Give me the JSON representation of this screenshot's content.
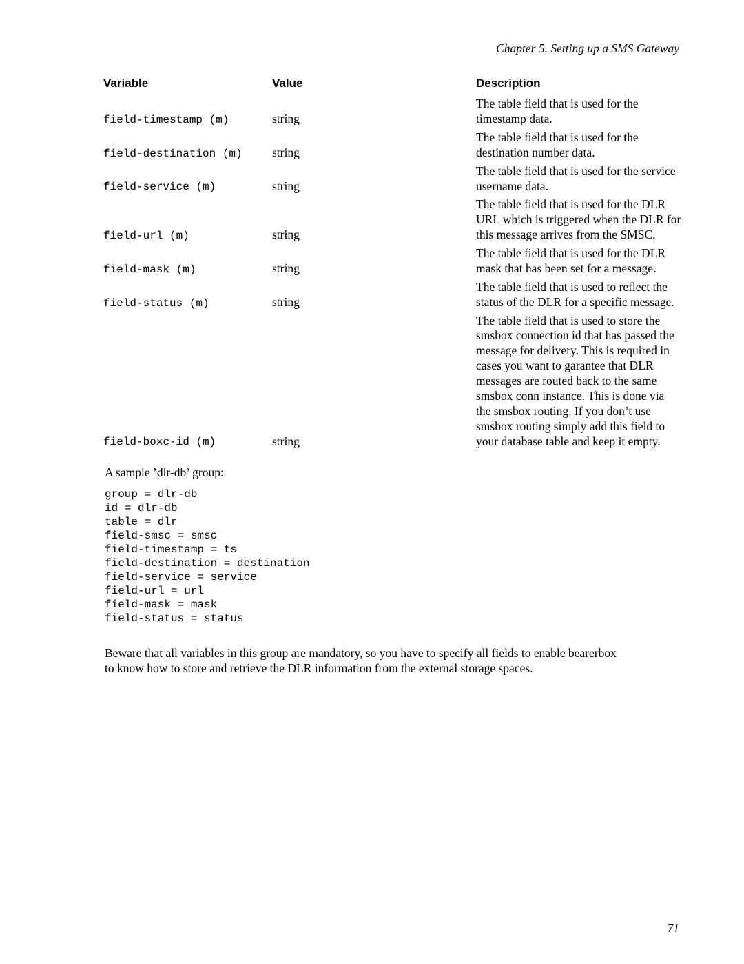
{
  "header": {
    "running_head": "Chapter 5. Setting up a SMS Gateway"
  },
  "table": {
    "columns": {
      "variable": "Variable",
      "value": "Value",
      "description": "Description"
    },
    "rows": [
      {
        "variable": "field-timestamp (m)",
        "value": "string",
        "description": "The table field that is used for the timestamp data."
      },
      {
        "variable": "field-destination (m)",
        "value": "string",
        "description": "The table field that is used for the destination number data."
      },
      {
        "variable": "field-service (m)",
        "value": "string",
        "description": "The table field that is used for the service username data."
      },
      {
        "variable": "field-url (m)",
        "value": "string",
        "description": "The table field that is used for the DLR URL which is triggered when the DLR for this message arrives from the SMSC."
      },
      {
        "variable": "field-mask (m)",
        "value": "string",
        "description": "The table field that is used for the DLR mask that has been set for a message."
      },
      {
        "variable": "field-status (m)",
        "value": "string",
        "description": "The table field that is used to reflect the status of the DLR for a specific message."
      },
      {
        "variable": "field-boxc-id (m)",
        "value": "string",
        "description": "The table field that is used to store the smsbox connection id that has passed the message for delivery. This is required in cases you want to garantee that DLR messages are routed back to the same smsbox conn instance. This is done via the smsbox routing. If you don’t use smsbox routing simply add this field to your database table and keep it empty."
      }
    ]
  },
  "sample": {
    "intro": "A sample ’dlr-db’ group:",
    "code": "group = dlr-db\nid = dlr-db\ntable = dlr\nfield-smsc = smsc\nfield-timestamp = ts\nfield-destination = destination\nfield-service = service\nfield-url = url\nfield-mask = mask\nfield-status = status"
  },
  "note": "Beware that all variables in this group are mandatory, so you have to specify all fields to enable bearerbox to know how to store and retrieve the DLR information from the external storage spaces.",
  "page_number": "71"
}
